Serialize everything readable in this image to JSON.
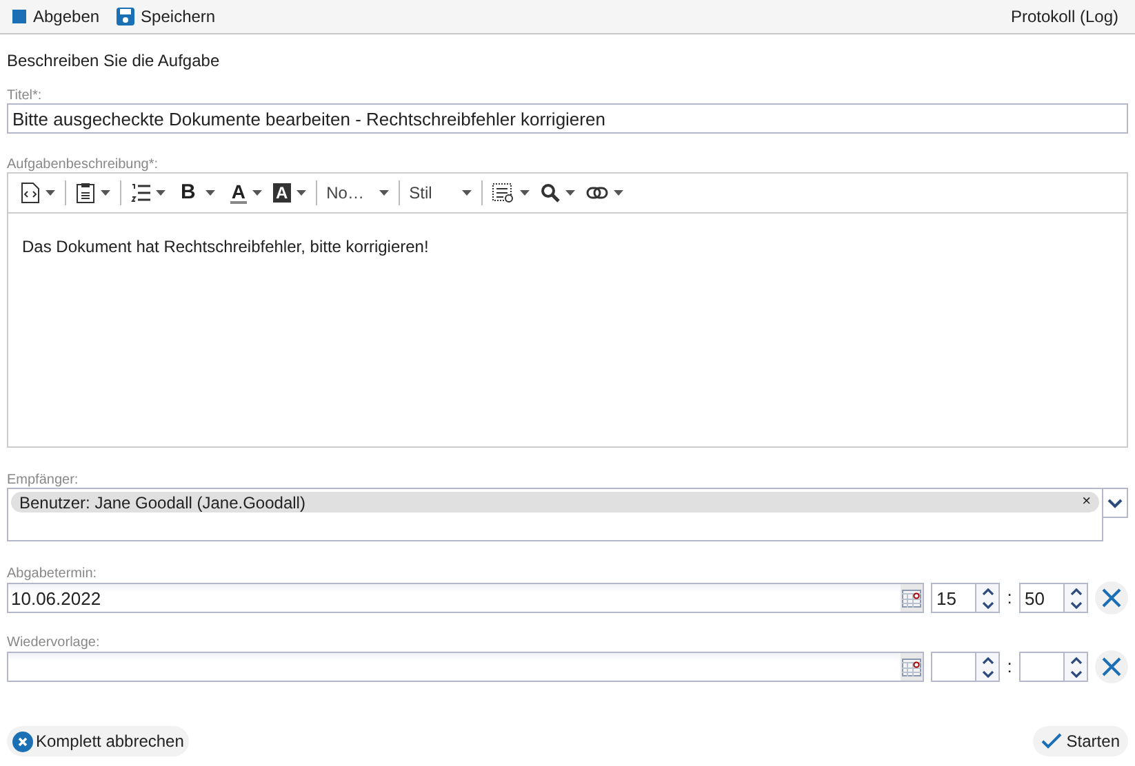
{
  "toolbar": {
    "actions": [
      {
        "label": "Abgeben"
      },
      {
        "label": "Speichern"
      }
    ],
    "right_link": "Protokoll (Log)"
  },
  "heading": "Beschreiben Sie die Aufgabe",
  "title_field": {
    "label": "Titel*:",
    "value": "Bitte ausgecheckte Dokumente bearbeiten - Rechtschreibfehler korrigieren"
  },
  "description": {
    "label": "Aufgabenbeschreibung*:",
    "editor_toolbar": [
      {
        "kind": "icon"
      },
      {
        "kind": "separator"
      },
      {
        "kind": "icon"
      },
      {
        "kind": "separator"
      },
      {
        "kind": "icon"
      },
      {
        "kind": "glyph",
        "text": "B"
      },
      {
        "kind": "glyph-underline",
        "text": "A"
      },
      {
        "kind": "glyph-box",
        "text": "A"
      },
      {
        "kind": "separator"
      },
      {
        "kind": "select",
        "text": "No…"
      },
      {
        "kind": "separator"
      },
      {
        "kind": "select",
        "text": "Stil"
      },
      {
        "kind": "separator"
      },
      {
        "kind": "icon"
      },
      {
        "kind": "icon"
      },
      {
        "kind": "icon"
      }
    ],
    "content": "Das Dokument hat Rechtschreibfehler, bitte korrigieren!"
  },
  "recipients": {
    "label": "Empfänger:",
    "tags": [
      {
        "text": "Benutzer: Jane Goodall (Jane.Goodall)",
        "remove": "×"
      }
    ]
  },
  "deadlines": [
    {
      "label": "Abgabetermin:",
      "date": "10.06.2022",
      "hour": "15",
      "minute": "50",
      "separator": ":"
    },
    {
      "label": "Wiedervorlage:",
      "separator": ":"
    }
  ],
  "footer": {
    "cancel": "Komplett abbrechen",
    "start": "Starten"
  }
}
